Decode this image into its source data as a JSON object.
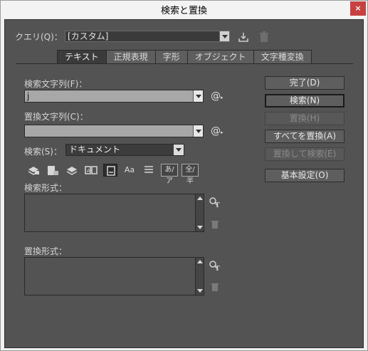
{
  "window": {
    "title": "検索と置換",
    "close_glyph": "×"
  },
  "query": {
    "label": "クエリ(Q)：",
    "value": "[カスタム]",
    "save_icon": "save-query-icon",
    "delete_icon": "trash-icon"
  },
  "tabs": [
    {
      "label": "テキスト",
      "active": true
    },
    {
      "label": "正規表現",
      "active": false
    },
    {
      "label": "字形",
      "active": false
    },
    {
      "label": "オブジェクト",
      "active": false
    },
    {
      "label": "文字種変換",
      "active": false
    }
  ],
  "find": {
    "label": "検索文字列(F)：",
    "value": "j",
    "special_glyph": "@",
    "special_sub": "▸"
  },
  "replace": {
    "label": "置換文字列(C)：",
    "value": "",
    "special_glyph": "@",
    "special_sub": "▸"
  },
  "search_scope": {
    "label": "検索(S)：",
    "value": "ドキュメント"
  },
  "options": {
    "kana": "あ/ア",
    "width": "全/半",
    "case": "Aa"
  },
  "find_format": {
    "label": "検索形式："
  },
  "replace_format": {
    "label": "置換形式："
  },
  "buttons": {
    "done": "完了(D)",
    "find": "検索(N)",
    "replace": "置換(H)",
    "replace_all": "すべてを置換(A)",
    "replace_find": "置換して検索(E)",
    "fewer_options": "基本設定(O)"
  },
  "colors": {
    "panel": "#535353",
    "field": "#a8a8a8",
    "close": "#c94040"
  }
}
